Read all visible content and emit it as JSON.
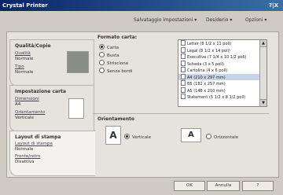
{
  "window": {
    "title": "Crystal Printer",
    "title_buttons": "?|X"
  },
  "menu": {
    "settings": "Salvataggio impostazioni ▾",
    "defaults": "Desiderio ▾",
    "options": "Opzioni ▾"
  },
  "sidebar": {
    "quality": {
      "title": "Qualità/Copie",
      "link1": "Qualità",
      "val1": "Normale",
      "link2": "Tipo",
      "val2": "Normale"
    },
    "paper": {
      "title": "Impostazione carta",
      "link1": "Dimensioni",
      "val1": "A4",
      "link2": "Orientamento",
      "val2": "Verticale"
    },
    "layout": {
      "title": "Layout di stampa",
      "link1": "Layout di stampa",
      "val1": "Normale",
      "link2": "Fronte/retro",
      "val2": "Disattiva"
    }
  },
  "paper_format": {
    "title": "Formato carta:",
    "options": [
      {
        "label": "Carta",
        "selected": true
      },
      {
        "label": "Busta",
        "selected": false
      },
      {
        "label": "Striscione",
        "selected": false
      },
      {
        "label": "Senza bordi",
        "selected": false
      }
    ],
    "sizes": [
      "Letter (8 1/2 x 11 poll)",
      "Legal (8 1/2 x 14 poll)",
      "Executive (7 1/4 x 10 1/2 poll)",
      "Scheda (3 x 5 poll)",
      "Cartolina (4 x 6 poll)",
      "A4 (210 x 297 mm)",
      "B5 (182 x 257 mm)",
      "A5 (148 x 210 mm)",
      "Statement (5 1/2 x 8 1/2 poll)"
    ],
    "selected_size_index": 5
  },
  "orientation": {
    "title": "Orientamento",
    "portrait": "Verticale",
    "landscape": "Orizzontale",
    "selected": "portrait"
  },
  "buttons": {
    "ok": "OK",
    "cancel": "Annulla",
    "help": "?"
  }
}
